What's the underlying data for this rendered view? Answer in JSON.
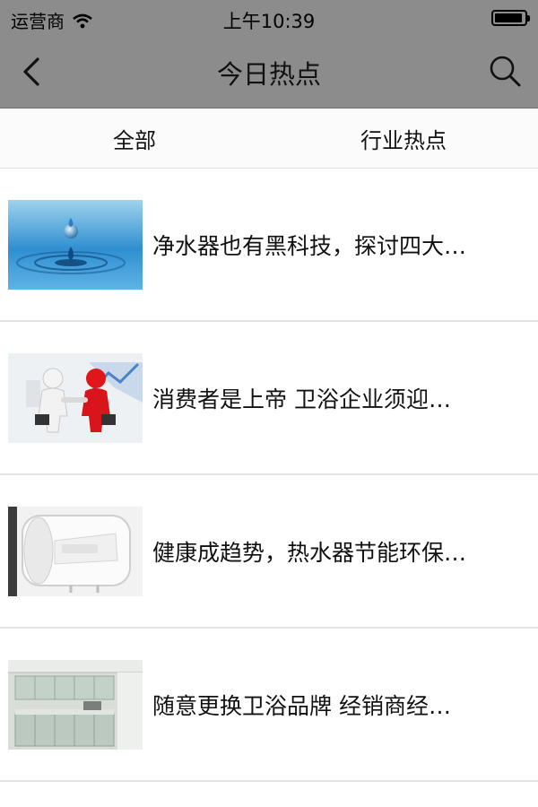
{
  "status_bar": {
    "carrier": "运营商",
    "time": "上午10:39",
    "battery_level": 0.95
  },
  "nav": {
    "back_icon": "chevron-left-icon",
    "title": "今日热点",
    "search_icon": "search-icon"
  },
  "tabs": [
    {
      "label": "全部"
    },
    {
      "label": "行业热点"
    }
  ],
  "articles": [
    {
      "title": "净水器也有黑科技，探讨四大…",
      "image": "water-drop"
    },
    {
      "title": "消费者是上帝 卫浴企业须迎…",
      "image": "handshake"
    },
    {
      "title": "健康成趋势，热水器节能环保…",
      "image": "water-heater"
    },
    {
      "title": "随意更换卫浴品牌 经销商经…",
      "image": "kitchen"
    }
  ],
  "colors": {
    "bar": "#8c8c8c",
    "tab_bg": "#fbfbfb",
    "divider": "#e3e3e3"
  }
}
